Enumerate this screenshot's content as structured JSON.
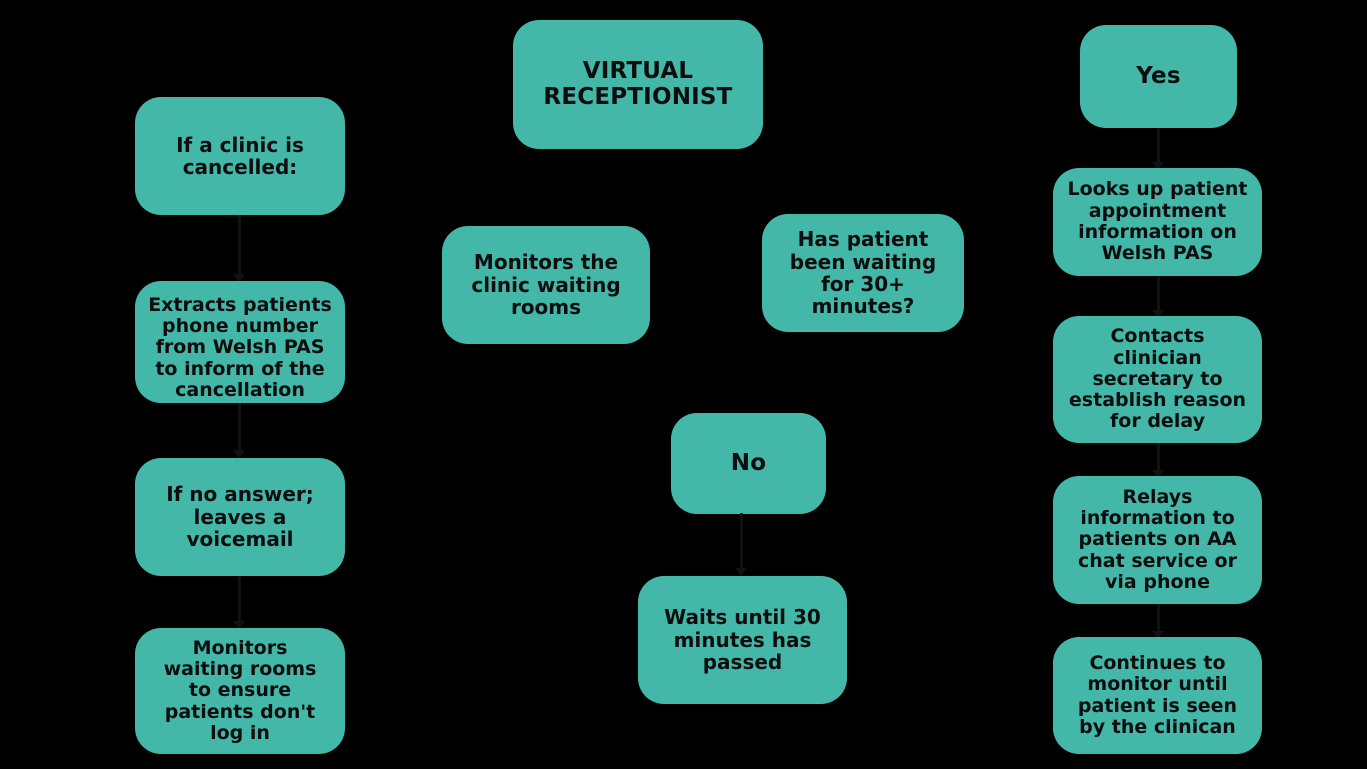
{
  "diagram": {
    "title": "VIRTUAL RECEPTIONIST",
    "accent_color": "#43b8a9",
    "background_color": "#000000",
    "text_color": "#0d0d0d"
  },
  "nodes": {
    "title_box": "VIRTUAL\nRECEPTIONIST",
    "left": {
      "clinic_cancelled": "If a clinic is\ncancelled:",
      "extracts_phone": "Extracts patients\nphone number\nfrom Welsh PAS\nto inform of the\ncancellation",
      "no_answer": "If no answer;\nleaves a\nvoicemail",
      "monitors_waiting": "Monitors\nwaiting rooms\nto ensure\npatients don't\nlog in"
    },
    "middle": {
      "monitors_clinic": "Monitors the\nclinic waiting\nrooms",
      "has_patient_waiting": "Has patient\nbeen waiting\nfor 30+\nminutes?",
      "no": "No",
      "waits_30": "Waits until 30\nminutes has\npassed"
    },
    "right": {
      "yes": "Yes",
      "looks_up": "Looks up patient\nappointment\ninformation on\nWelsh PAS",
      "contacts_secretary": "Contacts\nclinician\nsecretary to\nestablish reason\nfor delay",
      "relays_info": "Relays\ninformation to\npatients on AA\nchat service or\nvia phone",
      "continues_monitor": "Continues to\nmonitor until\npatient is seen\nby the clinican"
    }
  }
}
